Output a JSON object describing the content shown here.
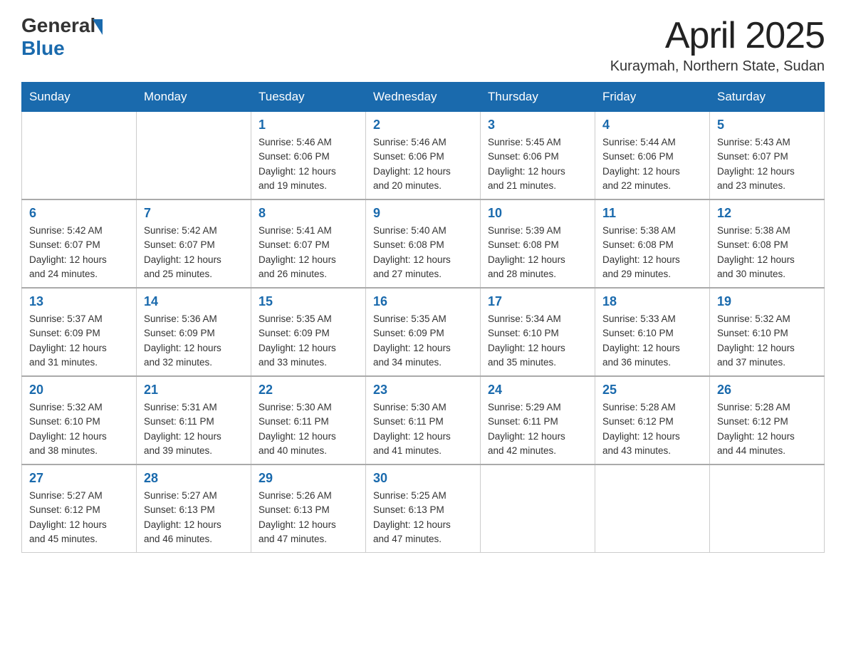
{
  "header": {
    "logo_general": "General",
    "logo_blue": "Blue",
    "month_year": "April 2025",
    "location": "Kuraymah, Northern State, Sudan"
  },
  "days_of_week": [
    "Sunday",
    "Monday",
    "Tuesday",
    "Wednesday",
    "Thursday",
    "Friday",
    "Saturday"
  ],
  "weeks": [
    [
      {
        "day": "",
        "info": ""
      },
      {
        "day": "",
        "info": ""
      },
      {
        "day": "1",
        "info": "Sunrise: 5:46 AM\nSunset: 6:06 PM\nDaylight: 12 hours\nand 19 minutes."
      },
      {
        "day": "2",
        "info": "Sunrise: 5:46 AM\nSunset: 6:06 PM\nDaylight: 12 hours\nand 20 minutes."
      },
      {
        "day": "3",
        "info": "Sunrise: 5:45 AM\nSunset: 6:06 PM\nDaylight: 12 hours\nand 21 minutes."
      },
      {
        "day": "4",
        "info": "Sunrise: 5:44 AM\nSunset: 6:06 PM\nDaylight: 12 hours\nand 22 minutes."
      },
      {
        "day": "5",
        "info": "Sunrise: 5:43 AM\nSunset: 6:07 PM\nDaylight: 12 hours\nand 23 minutes."
      }
    ],
    [
      {
        "day": "6",
        "info": "Sunrise: 5:42 AM\nSunset: 6:07 PM\nDaylight: 12 hours\nand 24 minutes."
      },
      {
        "day": "7",
        "info": "Sunrise: 5:42 AM\nSunset: 6:07 PM\nDaylight: 12 hours\nand 25 minutes."
      },
      {
        "day": "8",
        "info": "Sunrise: 5:41 AM\nSunset: 6:07 PM\nDaylight: 12 hours\nand 26 minutes."
      },
      {
        "day": "9",
        "info": "Sunrise: 5:40 AM\nSunset: 6:08 PM\nDaylight: 12 hours\nand 27 minutes."
      },
      {
        "day": "10",
        "info": "Sunrise: 5:39 AM\nSunset: 6:08 PM\nDaylight: 12 hours\nand 28 minutes."
      },
      {
        "day": "11",
        "info": "Sunrise: 5:38 AM\nSunset: 6:08 PM\nDaylight: 12 hours\nand 29 minutes."
      },
      {
        "day": "12",
        "info": "Sunrise: 5:38 AM\nSunset: 6:08 PM\nDaylight: 12 hours\nand 30 minutes."
      }
    ],
    [
      {
        "day": "13",
        "info": "Sunrise: 5:37 AM\nSunset: 6:09 PM\nDaylight: 12 hours\nand 31 minutes."
      },
      {
        "day": "14",
        "info": "Sunrise: 5:36 AM\nSunset: 6:09 PM\nDaylight: 12 hours\nand 32 minutes."
      },
      {
        "day": "15",
        "info": "Sunrise: 5:35 AM\nSunset: 6:09 PM\nDaylight: 12 hours\nand 33 minutes."
      },
      {
        "day": "16",
        "info": "Sunrise: 5:35 AM\nSunset: 6:09 PM\nDaylight: 12 hours\nand 34 minutes."
      },
      {
        "day": "17",
        "info": "Sunrise: 5:34 AM\nSunset: 6:10 PM\nDaylight: 12 hours\nand 35 minutes."
      },
      {
        "day": "18",
        "info": "Sunrise: 5:33 AM\nSunset: 6:10 PM\nDaylight: 12 hours\nand 36 minutes."
      },
      {
        "day": "19",
        "info": "Sunrise: 5:32 AM\nSunset: 6:10 PM\nDaylight: 12 hours\nand 37 minutes."
      }
    ],
    [
      {
        "day": "20",
        "info": "Sunrise: 5:32 AM\nSunset: 6:10 PM\nDaylight: 12 hours\nand 38 minutes."
      },
      {
        "day": "21",
        "info": "Sunrise: 5:31 AM\nSunset: 6:11 PM\nDaylight: 12 hours\nand 39 minutes."
      },
      {
        "day": "22",
        "info": "Sunrise: 5:30 AM\nSunset: 6:11 PM\nDaylight: 12 hours\nand 40 minutes."
      },
      {
        "day": "23",
        "info": "Sunrise: 5:30 AM\nSunset: 6:11 PM\nDaylight: 12 hours\nand 41 minutes."
      },
      {
        "day": "24",
        "info": "Sunrise: 5:29 AM\nSunset: 6:11 PM\nDaylight: 12 hours\nand 42 minutes."
      },
      {
        "day": "25",
        "info": "Sunrise: 5:28 AM\nSunset: 6:12 PM\nDaylight: 12 hours\nand 43 minutes."
      },
      {
        "day": "26",
        "info": "Sunrise: 5:28 AM\nSunset: 6:12 PM\nDaylight: 12 hours\nand 44 minutes."
      }
    ],
    [
      {
        "day": "27",
        "info": "Sunrise: 5:27 AM\nSunset: 6:12 PM\nDaylight: 12 hours\nand 45 minutes."
      },
      {
        "day": "28",
        "info": "Sunrise: 5:27 AM\nSunset: 6:13 PM\nDaylight: 12 hours\nand 46 minutes."
      },
      {
        "day": "29",
        "info": "Sunrise: 5:26 AM\nSunset: 6:13 PM\nDaylight: 12 hours\nand 47 minutes."
      },
      {
        "day": "30",
        "info": "Sunrise: 5:25 AM\nSunset: 6:13 PM\nDaylight: 12 hours\nand 47 minutes."
      },
      {
        "day": "",
        "info": ""
      },
      {
        "day": "",
        "info": ""
      },
      {
        "day": "",
        "info": ""
      }
    ]
  ]
}
